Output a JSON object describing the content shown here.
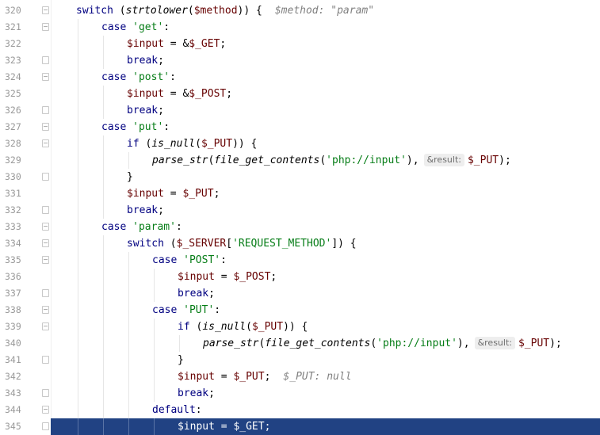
{
  "editor": {
    "selected_line": 345,
    "lines": [
      {
        "n": "320",
        "text": "switch (strtolower($method)) {",
        "hint": "$method: \"param\""
      },
      {
        "n": "321",
        "text": "case 'get':"
      },
      {
        "n": "322",
        "text": "$input = &$_GET;"
      },
      {
        "n": "323",
        "text": "break;"
      },
      {
        "n": "324",
        "text": "case 'post':"
      },
      {
        "n": "325",
        "text": "$input = &$_POST;"
      },
      {
        "n": "326",
        "text": "break;"
      },
      {
        "n": "327",
        "text": "case 'put':"
      },
      {
        "n": "328",
        "text": "if (is_null($_PUT)) {"
      },
      {
        "n": "329",
        "text": "parse_str(file_get_contents('php://input'),",
        "inlay": "&result:",
        "rest": "$_PUT);"
      },
      {
        "n": "330",
        "text": "}"
      },
      {
        "n": "331",
        "text": "$input = $_PUT;"
      },
      {
        "n": "332",
        "text": "break;"
      },
      {
        "n": "333",
        "text": "case 'param':"
      },
      {
        "n": "334",
        "text": "switch ($_SERVER['REQUEST_METHOD']) {"
      },
      {
        "n": "335",
        "text": "case 'POST':"
      },
      {
        "n": "336",
        "text": "$input = $_POST;"
      },
      {
        "n": "337",
        "text": "break;"
      },
      {
        "n": "338",
        "text": "case 'PUT':"
      },
      {
        "n": "339",
        "text": "if (is_null($_PUT)) {"
      },
      {
        "n": "340",
        "text": "parse_str(file_get_contents('php://input'),",
        "inlay": "&result:",
        "rest": "$_PUT);"
      },
      {
        "n": "341",
        "text": "}"
      },
      {
        "n": "342",
        "text": "$input = $_PUT;",
        "hint": "$_PUT: null"
      },
      {
        "n": "343",
        "text": "break;"
      },
      {
        "n": "344",
        "text": "default:"
      },
      {
        "n": "345",
        "text": "$input = $_GET;"
      }
    ]
  },
  "colors": {
    "selection": "#214283",
    "keyword": "#000080",
    "string": "#067d17",
    "variable": "#660000"
  }
}
